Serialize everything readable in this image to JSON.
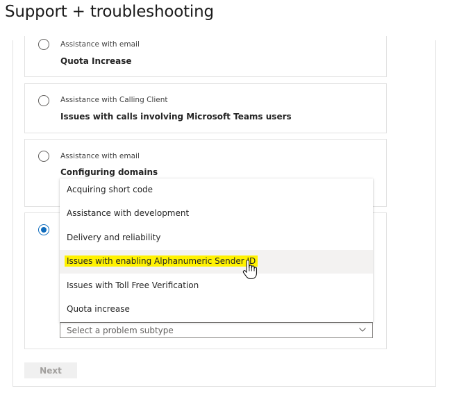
{
  "page": {
    "title": "Support + troubleshooting"
  },
  "cards": [
    {
      "category": "Assistance with email",
      "title": "Quota Increase",
      "selected": false
    },
    {
      "category": "Assistance with Calling Client",
      "title": "Issues with calls involving Microsoft Teams users",
      "selected": false
    },
    {
      "category": "Assistance with email",
      "title": "Configuring domains",
      "selected": false
    },
    {
      "category": "",
      "title": "",
      "selected": true
    }
  ],
  "problem_subtype": {
    "placeholder": "Select a problem subtype",
    "options": [
      "Acquiring short code",
      "Assistance with development",
      "Delivery and reliability",
      "Issues with enabling Alphanumeric Sender ID",
      "Issues with Toll Free Verification",
      "Quota increase"
    ],
    "hovered_index": 3
  },
  "buttons": {
    "next_label": "Next"
  },
  "colors": {
    "accent": "#0f6cbd",
    "highlight": "#fff200",
    "hover_bg": "#f3f2f1",
    "border": "#e1e1e1"
  },
  "icons": {
    "cursor": "hand-pointer-icon",
    "chevron": "chevron-down-icon"
  }
}
